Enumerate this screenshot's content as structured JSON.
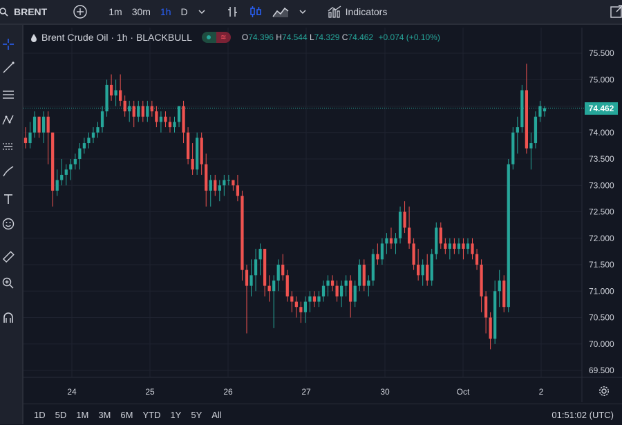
{
  "topbar": {
    "symbol": "BRENT",
    "intervals": [
      "1m",
      "30m",
      "1h",
      "D"
    ],
    "active_interval": "1h",
    "indicators_label": "Indicators"
  },
  "legend": {
    "title": "Brent Crude Oil · 1h · BLACKBULL",
    "o_label": "O",
    "o_value": "74.396",
    "h_label": "H",
    "h_value": "74.544",
    "l_label": "L",
    "l_value": "74.329",
    "c_label": "C",
    "c_value": "74.462",
    "change": "+0.074 (+0.10%)"
  },
  "price_badge": "74.462",
  "ranges": [
    "1D",
    "5D",
    "1M",
    "3M",
    "6M",
    "YTD",
    "1Y",
    "5Y",
    "All"
  ],
  "clock": "01:51:02 (UTC)",
  "colors": {
    "up": "#26a69a",
    "down": "#ef5350",
    "bg": "#131722",
    "grid": "#1f2330"
  },
  "chart_data": {
    "type": "candlestick",
    "y_ticks": [
      "75.500",
      "75.000",
      "74.500",
      "74.000",
      "73.500",
      "73.000",
      "72.500",
      "72.000",
      "71.500",
      "71.000",
      "70.500",
      "70.000",
      "69.500"
    ],
    "x_ticks": [
      "24",
      "25",
      "26",
      "27",
      "30",
      "Oct",
      "2"
    ],
    "ylim": [
      69.3,
      75.7
    ],
    "last_price": 74.462,
    "candles": [
      [
        73.9,
        74.1,
        73.7,
        73.8
      ],
      [
        73.8,
        74.2,
        73.7,
        74.0
      ],
      [
        74.0,
        74.4,
        73.9,
        74.3
      ],
      [
        74.3,
        74.3,
        73.9,
        74.0
      ],
      [
        74.0,
        74.4,
        73.8,
        74.3
      ],
      [
        74.3,
        74.4,
        73.4,
        74.0
      ],
      [
        74.0,
        74.0,
        72.6,
        72.9
      ],
      [
        72.9,
        73.3,
        72.8,
        73.1
      ],
      [
        73.1,
        73.5,
        73.0,
        73.2
      ],
      [
        73.2,
        73.4,
        73.0,
        73.3
      ],
      [
        73.3,
        73.5,
        73.1,
        73.4
      ],
      [
        73.4,
        73.6,
        73.3,
        73.5
      ],
      [
        73.5,
        73.8,
        73.3,
        73.7
      ],
      [
        73.7,
        73.9,
        73.6,
        73.8
      ],
      [
        73.8,
        74.0,
        73.7,
        73.9
      ],
      [
        73.9,
        74.1,
        73.8,
        74.0
      ],
      [
        74.0,
        74.2,
        73.9,
        74.1
      ],
      [
        74.1,
        74.5,
        74.0,
        74.4
      ],
      [
        74.4,
        75.0,
        74.3,
        74.9
      ],
      [
        74.9,
        75.1,
        74.6,
        74.7
      ],
      [
        74.7,
        75.0,
        74.5,
        74.8
      ],
      [
        74.8,
        75.1,
        74.5,
        74.6
      ],
      [
        74.6,
        74.7,
        74.3,
        74.4
      ],
      [
        74.4,
        74.6,
        74.2,
        74.5
      ],
      [
        74.5,
        74.6,
        74.1,
        74.3
      ],
      [
        74.3,
        74.6,
        74.2,
        74.5
      ],
      [
        74.5,
        74.6,
        74.2,
        74.3
      ],
      [
        74.3,
        74.6,
        74.2,
        74.5
      ],
      [
        74.5,
        74.6,
        74.3,
        74.4
      ],
      [
        74.4,
        74.5,
        74.1,
        74.2
      ],
      [
        74.2,
        74.4,
        74.0,
        74.3
      ],
      [
        74.3,
        74.4,
        74.1,
        74.2
      ],
      [
        74.2,
        74.3,
        74.0,
        74.1
      ],
      [
        74.1,
        74.3,
        74.0,
        74.2
      ],
      [
        74.2,
        74.5,
        74.1,
        74.5
      ],
      [
        74.5,
        74.6,
        73.8,
        74.0
      ],
      [
        74.0,
        74.1,
        73.4,
        73.5
      ],
      [
        73.5,
        73.8,
        73.2,
        73.3
      ],
      [
        73.3,
        74.0,
        73.2,
        73.9
      ],
      [
        73.9,
        74.0,
        73.2,
        73.4
      ],
      [
        73.4,
        73.6,
        72.6,
        72.9
      ],
      [
        72.9,
        73.2,
        72.6,
        73.1
      ],
      [
        73.1,
        73.2,
        72.8,
        72.9
      ],
      [
        72.9,
        73.1,
        72.7,
        73.0
      ],
      [
        73.0,
        73.2,
        72.8,
        73.1
      ],
      [
        73.1,
        73.2,
        73.0,
        73.1
      ],
      [
        73.1,
        73.1,
        72.9,
        73.0
      ],
      [
        73.0,
        73.2,
        72.7,
        72.8
      ],
      [
        72.8,
        72.9,
        71.2,
        71.4
      ],
      [
        71.4,
        71.5,
        70.2,
        71.1
      ],
      [
        71.1,
        71.6,
        70.9,
        71.3
      ],
      [
        71.3,
        71.8,
        71.0,
        71.6
      ],
      [
        71.6,
        71.9,
        71.3,
        71.8
      ],
      [
        71.8,
        71.8,
        70.9,
        71.1
      ],
      [
        71.1,
        71.3,
        70.8,
        71.0
      ],
      [
        71.0,
        71.3,
        70.3,
        71.2
      ],
      [
        71.2,
        71.6,
        71.0,
        71.5
      ],
      [
        71.5,
        71.7,
        71.2,
        71.3
      ],
      [
        71.3,
        71.4,
        70.8,
        70.9
      ],
      [
        70.9,
        71.0,
        70.6,
        70.8
      ],
      [
        70.8,
        70.9,
        70.5,
        70.7
      ],
      [
        70.7,
        70.8,
        70.4,
        70.6
      ],
      [
        70.6,
        70.9,
        70.4,
        70.8
      ],
      [
        70.8,
        71.0,
        70.6,
        70.9
      ],
      [
        70.9,
        71.0,
        70.7,
        70.8
      ],
      [
        70.8,
        71.0,
        70.7,
        70.9
      ],
      [
        70.9,
        71.2,
        70.8,
        71.1
      ],
      [
        71.1,
        71.3,
        70.9,
        71.2
      ],
      [
        71.2,
        71.3,
        71.0,
        71.1
      ],
      [
        71.1,
        71.2,
        70.8,
        70.9
      ],
      [
        70.9,
        71.2,
        70.7,
        71.1
      ],
      [
        71.1,
        71.3,
        70.9,
        71.2
      ],
      [
        71.2,
        71.3,
        70.5,
        70.8
      ],
      [
        70.8,
        71.2,
        70.7,
        71.1
      ],
      [
        71.1,
        71.6,
        71.0,
        71.5
      ],
      [
        71.5,
        71.6,
        71.0,
        71.1
      ],
      [
        71.1,
        71.3,
        70.9,
        71.2
      ],
      [
        71.2,
        71.8,
        71.1,
        71.7
      ],
      [
        71.7,
        71.9,
        71.5,
        71.6
      ],
      [
        71.6,
        72.0,
        71.5,
        71.9
      ],
      [
        71.9,
        72.1,
        71.7,
        72.0
      ],
      [
        72.0,
        72.2,
        71.8,
        71.9
      ],
      [
        71.9,
        72.1,
        71.7,
        72.0
      ],
      [
        72.0,
        72.6,
        71.9,
        72.5
      ],
      [
        72.5,
        72.7,
        72.1,
        72.2
      ],
      [
        72.2,
        72.6,
        71.8,
        71.9
      ],
      [
        71.9,
        72.0,
        71.4,
        71.5
      ],
      [
        71.5,
        71.8,
        71.2,
        71.3
      ],
      [
        71.3,
        71.6,
        71.1,
        71.5
      ],
      [
        71.5,
        71.7,
        71.1,
        71.2
      ],
      [
        71.2,
        71.8,
        71.1,
        71.7
      ],
      [
        71.7,
        72.3,
        71.6,
        72.2
      ],
      [
        72.2,
        72.3,
        71.8,
        71.9
      ],
      [
        71.9,
        72.0,
        71.7,
        71.8
      ],
      [
        71.8,
        72.0,
        71.6,
        71.9
      ],
      [
        71.9,
        72.0,
        71.7,
        71.8
      ],
      [
        71.8,
        72.0,
        71.7,
        71.9
      ],
      [
        71.9,
        72.0,
        71.6,
        71.8
      ],
      [
        71.8,
        72.0,
        71.7,
        71.9
      ],
      [
        71.9,
        72.0,
        71.6,
        71.7
      ],
      [
        71.7,
        71.8,
        71.4,
        71.5
      ],
      [
        71.5,
        71.6,
        70.6,
        70.9
      ],
      [
        70.9,
        71.0,
        70.2,
        70.5
      ],
      [
        70.5,
        70.6,
        69.9,
        70.1
      ],
      [
        70.1,
        71.2,
        70.0,
        71.0
      ],
      [
        71.0,
        71.4,
        70.7,
        71.2
      ],
      [
        71.2,
        71.3,
        70.6,
        70.7
      ],
      [
        70.7,
        73.5,
        70.6,
        73.4
      ],
      [
        73.4,
        74.1,
        73.3,
        74.0
      ],
      [
        74.0,
        74.3,
        73.6,
        74.1
      ],
      [
        74.1,
        74.9,
        74.0,
        74.8
      ],
      [
        74.8,
        75.3,
        73.6,
        73.7
      ],
      [
        73.7,
        74.0,
        73.3,
        73.8
      ],
      [
        73.8,
        74.4,
        73.7,
        74.3
      ],
      [
        74.3,
        74.6,
        74.2,
        74.5
      ],
      [
        74.4,
        74.5,
        74.3,
        74.46
      ]
    ]
  }
}
